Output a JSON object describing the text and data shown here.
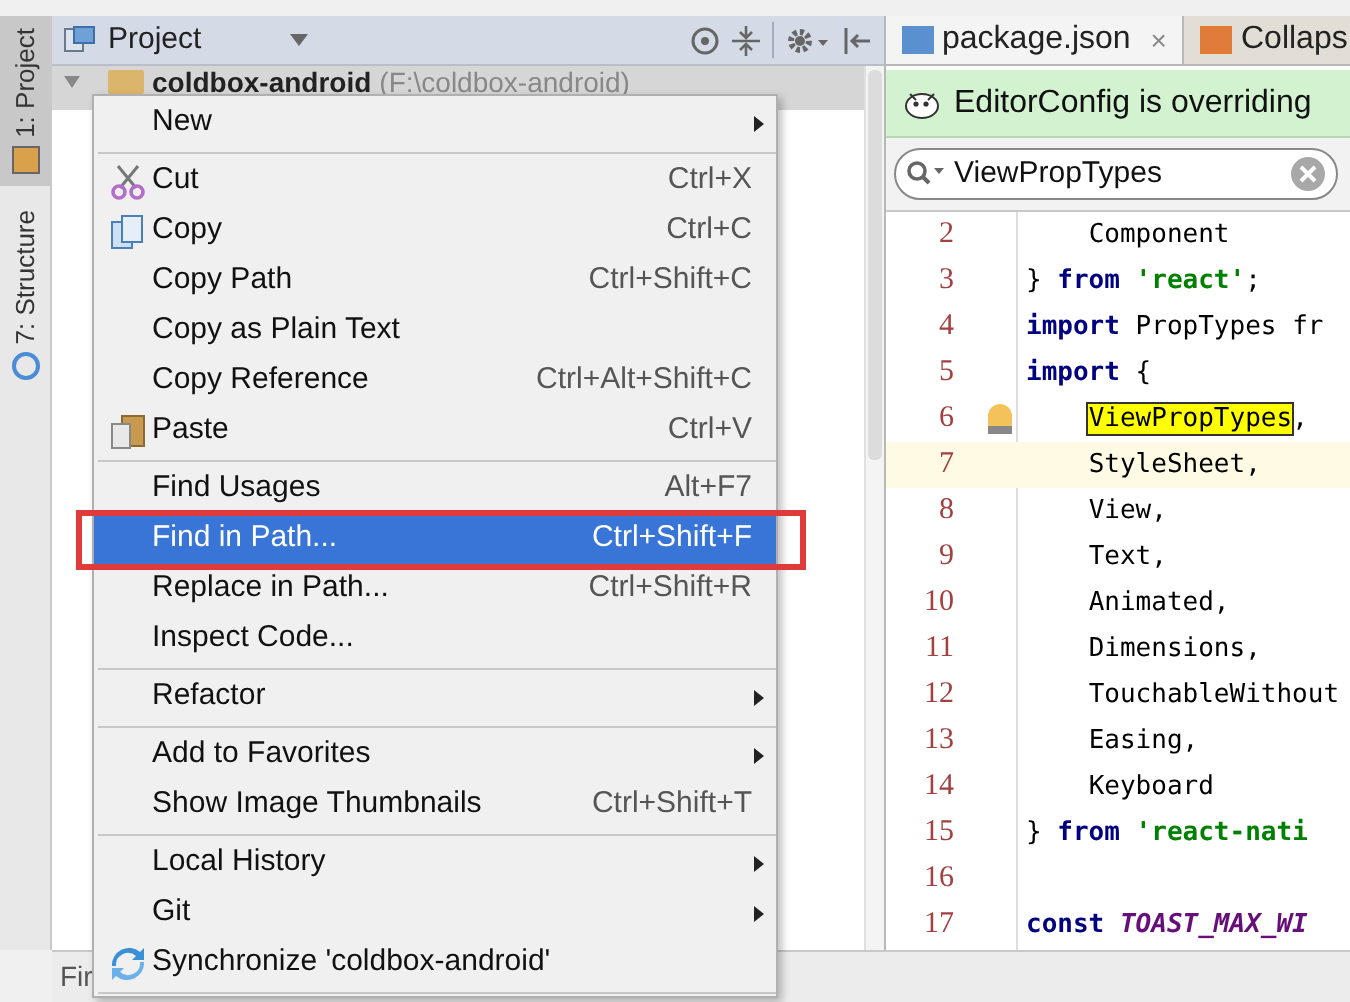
{
  "tool_strip": [
    {
      "label": "1: Project",
      "selected": true
    },
    {
      "label": "7: Structure",
      "selected": false
    }
  ],
  "project_panel": {
    "title": "Project",
    "tree": [
      {
        "name": "coldbox-android",
        "path": "(F:\\coldbox-android)",
        "expanded": true
      }
    ]
  },
  "editor": {
    "tabs": [
      {
        "label": "package.json",
        "selected": true,
        "close": "×"
      },
      {
        "label": "Collaps",
        "selected": false
      }
    ],
    "banner": "EditorConfig is overriding",
    "search": {
      "value": "ViewPropTypes"
    },
    "lines": [
      {
        "number": "2",
        "caret_line": false,
        "bulb": false,
        "tokens": [
          {
            "kind": "plain",
            "text": "    Component"
          }
        ]
      },
      {
        "number": "3",
        "caret_line": false,
        "bulb": false,
        "tokens": [
          {
            "kind": "plain",
            "text": "} "
          },
          {
            "kind": "keyword",
            "text": "from"
          },
          {
            "kind": "string",
            "text": " 'react'"
          },
          {
            "kind": "plain",
            "text": ";"
          }
        ]
      },
      {
        "number": "4",
        "caret_line": false,
        "bulb": false,
        "tokens": [
          {
            "kind": "keyword",
            "text": "import"
          },
          {
            "kind": "plain",
            "text": " PropTypes fr"
          }
        ]
      },
      {
        "number": "5",
        "caret_line": false,
        "bulb": false,
        "tokens": [
          {
            "kind": "keyword",
            "text": "import"
          },
          {
            "kind": "plain",
            "text": " {"
          }
        ]
      },
      {
        "number": "6",
        "caret_line": false,
        "bulb": true,
        "tokens": [
          {
            "kind": "match",
            "text": "    ViewPropTypes"
          },
          {
            "kind": "plain",
            "text": ","
          }
        ]
      },
      {
        "number": "7",
        "caret_line": true,
        "bulb": false,
        "tokens": [
          {
            "kind": "plain",
            "text": "    StyleSheet,"
          }
        ]
      },
      {
        "number": "8",
        "caret_line": false,
        "bulb": false,
        "tokens": [
          {
            "kind": "plain",
            "text": "    View,"
          }
        ]
      },
      {
        "number": "9",
        "caret_line": false,
        "bulb": false,
        "tokens": [
          {
            "kind": "plain",
            "text": "    Text,"
          }
        ]
      },
      {
        "number": "10",
        "caret_line": false,
        "bulb": false,
        "tokens": [
          {
            "kind": "plain",
            "text": "    Animated,"
          }
        ]
      },
      {
        "number": "11",
        "caret_line": false,
        "bulb": false,
        "tokens": [
          {
            "kind": "plain",
            "text": "    Dimensions,"
          }
        ]
      },
      {
        "number": "12",
        "caret_line": false,
        "bulb": false,
        "tokens": [
          {
            "kind": "plain",
            "text": "    TouchableWithout"
          }
        ]
      },
      {
        "number": "13",
        "caret_line": false,
        "bulb": false,
        "tokens": [
          {
            "kind": "plain",
            "text": "    Easing,"
          }
        ]
      },
      {
        "number": "14",
        "caret_line": false,
        "bulb": false,
        "tokens": [
          {
            "kind": "plain",
            "text": "    Keyboard"
          }
        ]
      },
      {
        "number": "15",
        "caret_line": false,
        "bulb": false,
        "tokens": [
          {
            "kind": "plain",
            "text": "} "
          },
          {
            "kind": "keyword",
            "text": "from"
          },
          {
            "kind": "string",
            "text": " 'react-nati"
          }
        ]
      },
      {
        "number": "16",
        "caret_line": false,
        "bulb": false
      },
      {
        "number": "17",
        "caret_line": false,
        "bulb": false,
        "tokens": [
          {
            "kind": "keyword",
            "text": "const"
          },
          {
            "kind": "constant",
            "text": " TOAST_MAX_WI"
          }
        ]
      }
    ]
  },
  "context_menu": [
    {
      "kind": "item",
      "label": "New",
      "has_submenu": true,
      "selected": false,
      "highlighted": false
    },
    {
      "kind": "separator"
    },
    {
      "kind": "item",
      "label": "Cut",
      "shortcut": "Ctrl+X",
      "has_submenu": false,
      "selected": false,
      "highlighted": false
    },
    {
      "kind": "item",
      "label": "Copy",
      "shortcut": "Ctrl+C",
      "has_submenu": false,
      "selected": false,
      "highlighted": false
    },
    {
      "kind": "item",
      "label": "Copy Path",
      "shortcut": "Ctrl+Shift+C",
      "has_submenu": false,
      "selected": false,
      "highlighted": false
    },
    {
      "kind": "item",
      "label": "Copy as Plain Text",
      "has_submenu": false,
      "selected": false,
      "highlighted": false
    },
    {
      "kind": "item",
      "label": "Copy Reference",
      "shortcut": "Ctrl+Alt+Shift+C",
      "has_submenu": false,
      "selected": false,
      "highlighted": false
    },
    {
      "kind": "item",
      "label": "Paste",
      "shortcut": "Ctrl+V",
      "has_submenu": false,
      "selected": false,
      "highlighted": false
    },
    {
      "kind": "separator"
    },
    {
      "kind": "item",
      "label": "Find Usages",
      "shortcut": "Alt+F7",
      "has_submenu": false,
      "selected": false,
      "highlighted": false
    },
    {
      "kind": "item",
      "label": "Find in Path...",
      "shortcut": "Ctrl+Shift+F",
      "has_submenu": false,
      "selected": true,
      "highlighted": true
    },
    {
      "kind": "item",
      "label": "Replace in Path...",
      "shortcut": "Ctrl+Shift+R",
      "has_submenu": false,
      "selected": false,
      "highlighted": false
    },
    {
      "kind": "item",
      "label": "Inspect Code...",
      "has_submenu": false,
      "selected": false,
      "highlighted": false
    },
    {
      "kind": "separator"
    },
    {
      "kind": "item",
      "label": "Refactor",
      "has_submenu": true,
      "selected": false,
      "highlighted": false
    },
    {
      "kind": "separator"
    },
    {
      "kind": "item",
      "label": "Add to Favorites",
      "has_submenu": true,
      "selected": false,
      "highlighted": false
    },
    {
      "kind": "item",
      "label": "Show Image Thumbnails",
      "shortcut": "Ctrl+Shift+T",
      "has_submenu": false,
      "selected": false,
      "highlighted": false
    },
    {
      "kind": "separator"
    },
    {
      "kind": "item",
      "label": "Local History",
      "has_submenu": true,
      "selected": false,
      "highlighted": false
    },
    {
      "kind": "item",
      "label": "Git",
      "has_submenu": true,
      "selected": false,
      "highlighted": false
    },
    {
      "kind": "item",
      "label": "Synchronize 'coldbox-android'",
      "has_submenu": false,
      "selected": false,
      "highlighted": false
    },
    {
      "kind": "separator"
    }
  ],
  "status_bar": "Fir"
}
